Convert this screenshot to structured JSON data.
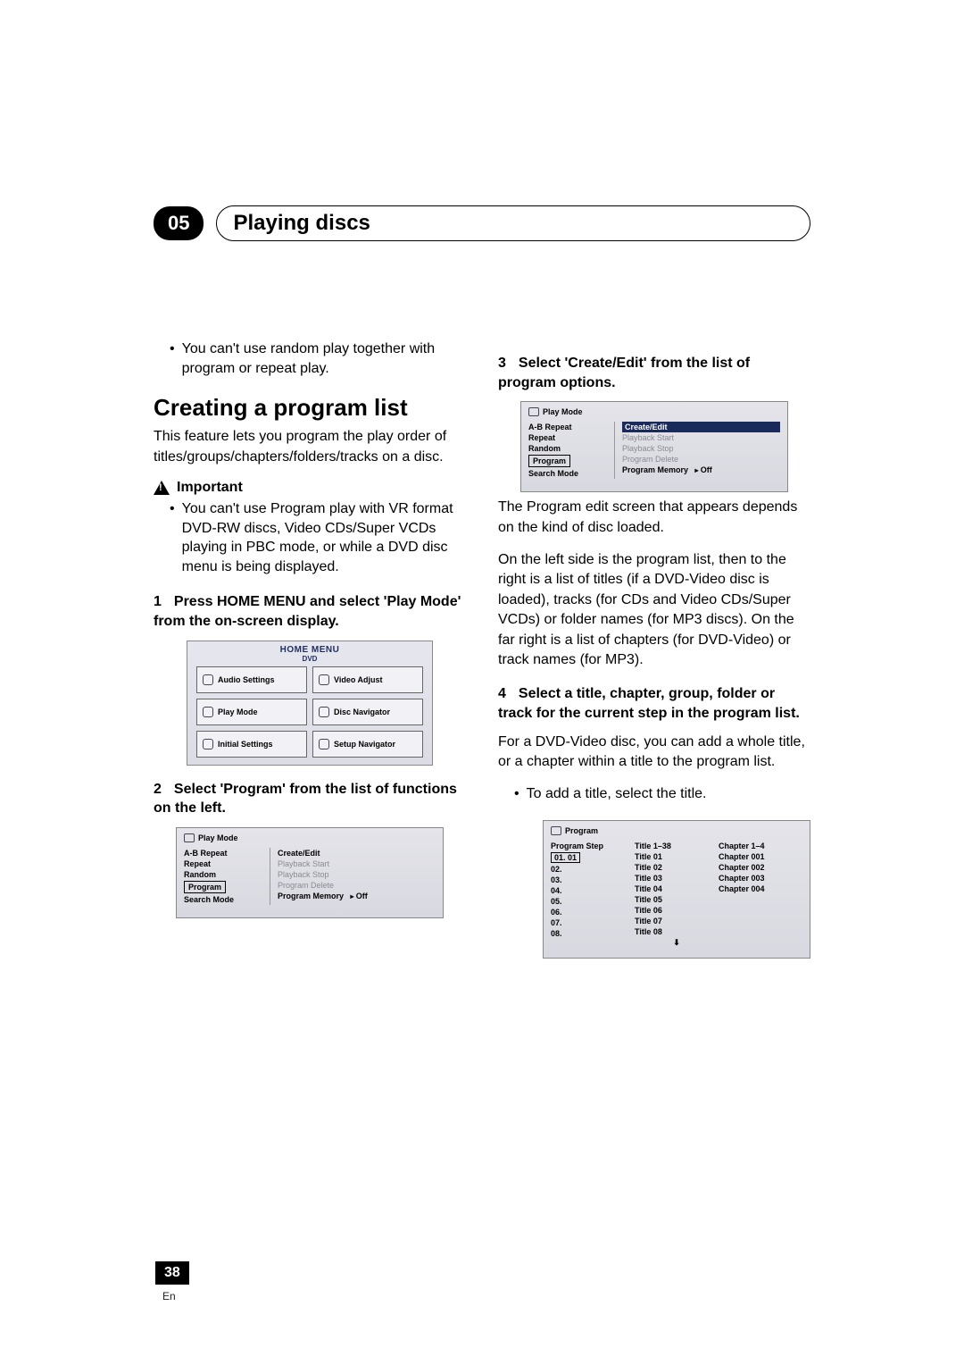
{
  "chapter_num": "05",
  "chapter_title": "Playing discs",
  "page_number": "38",
  "page_lang": "En",
  "left": {
    "note1": "You can't use random play together with program or repeat play.",
    "section_title": "Creating a program list",
    "intro": "This feature lets you program the play order of titles/groups/chapters/folders/tracks on a disc.",
    "important_label": "Important",
    "important_text": "You can't use Program play with VR format DVD-RW discs, Video CDs/Super VCDs playing in PBC mode, or while a DVD disc menu is being displayed.",
    "step1_num": "1",
    "step1": "Press HOME MENU and select 'Play Mode' from the on-screen display.",
    "home_menu": {
      "title": "HOME MENU",
      "sub": "DVD",
      "items": [
        "Audio Settings",
        "Video Adjust",
        "Play Mode",
        "Disc Navigator",
        "Initial Settings",
        "Setup Navigator"
      ]
    },
    "step2_num": "2",
    "step2": "Select 'Program' from the list of functions on the left.",
    "play_mode_panel": {
      "title": "Play Mode",
      "left_items": [
        "A-B Repeat",
        "Repeat",
        "Random",
        "Program",
        "Search Mode"
      ],
      "left_selected": "Program",
      "right_items": [
        {
          "label": "Create/Edit",
          "state": "normal"
        },
        {
          "label": "Playback Start",
          "state": "dim"
        },
        {
          "label": "Playback Stop",
          "state": "dim"
        },
        {
          "label": "Program Delete",
          "state": "dim"
        },
        {
          "label": "Program Memory",
          "state": "arrow",
          "suffix": "Off"
        }
      ]
    }
  },
  "right": {
    "step3_num": "3",
    "step3": "Select 'Create/Edit' from the list of program options.",
    "play_mode_panel2": {
      "title": "Play Mode",
      "left_items": [
        "A-B Repeat",
        "Repeat",
        "Random",
        "Program",
        "Search Mode"
      ],
      "left_selected": "Program",
      "right_selected": "Create/Edit",
      "right_items": [
        {
          "label": "Create/Edit",
          "state": "sel"
        },
        {
          "label": "Playback Start",
          "state": "dim"
        },
        {
          "label": "Playback Stop",
          "state": "dim"
        },
        {
          "label": "Program Delete",
          "state": "dim"
        },
        {
          "label": "Program Memory",
          "state": "arrow",
          "suffix": "Off"
        }
      ]
    },
    "para1": "The Program edit screen that appears depends on the kind of disc loaded.",
    "para2": "On the left side is the program list, then to the right is a list of titles (if a DVD-Video disc is loaded), tracks (for CDs and Video CDs/Super VCDs) or folder names (for MP3 discs). On the far right is a list of chapters (for DVD-Video) or track names (for MP3).",
    "step4_num": "4",
    "step4": "Select a title, chapter, group, folder or track for the current step in the program list.",
    "para3": "For a DVD-Video disc, you can add a whole title, or a chapter within a title to the program list.",
    "bullet_add": "To add a title, select the title.",
    "program_panel": {
      "title": "Program",
      "col_headers": [
        "Program Step",
        "Title 1–38",
        "Chapter 1–4"
      ],
      "steps": [
        "01. 01",
        "02.",
        "03.",
        "04.",
        "05.",
        "06.",
        "07.",
        "08."
      ],
      "titles": [
        "Title 01",
        "Title 02",
        "Title 03",
        "Title 04",
        "Title 05",
        "Title 06",
        "Title 07",
        "Title 08"
      ],
      "chapters": [
        "Chapter 001",
        "Chapter 002",
        "Chapter 003",
        "Chapter 004"
      ],
      "selected_step": "01. 01"
    }
  }
}
